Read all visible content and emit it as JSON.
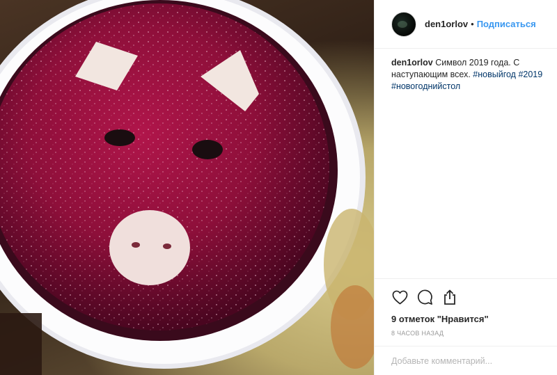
{
  "post": {
    "image_alt": "",
    "username": "den1orlov",
    "separator": "•",
    "follow_label": "Подписаться",
    "caption_text": "Символ 2019 года. С наступающим всех.",
    "hashtags": [
      "#новыйгод",
      "#2019",
      "#новогоднийстол"
    ],
    "likes_label": "9 отметок \"Нравится\"",
    "time_label": "8 часов назад",
    "comment_placeholder": "Добавьте комментарий..."
  },
  "icons": {
    "like": "heart-outline-icon",
    "comment": "speech-bubble-icon",
    "share": "share-upload-icon"
  },
  "colors": {
    "link": "#3897f0",
    "hashtag": "#003569",
    "muted": "#999999",
    "border": "#efefef"
  }
}
